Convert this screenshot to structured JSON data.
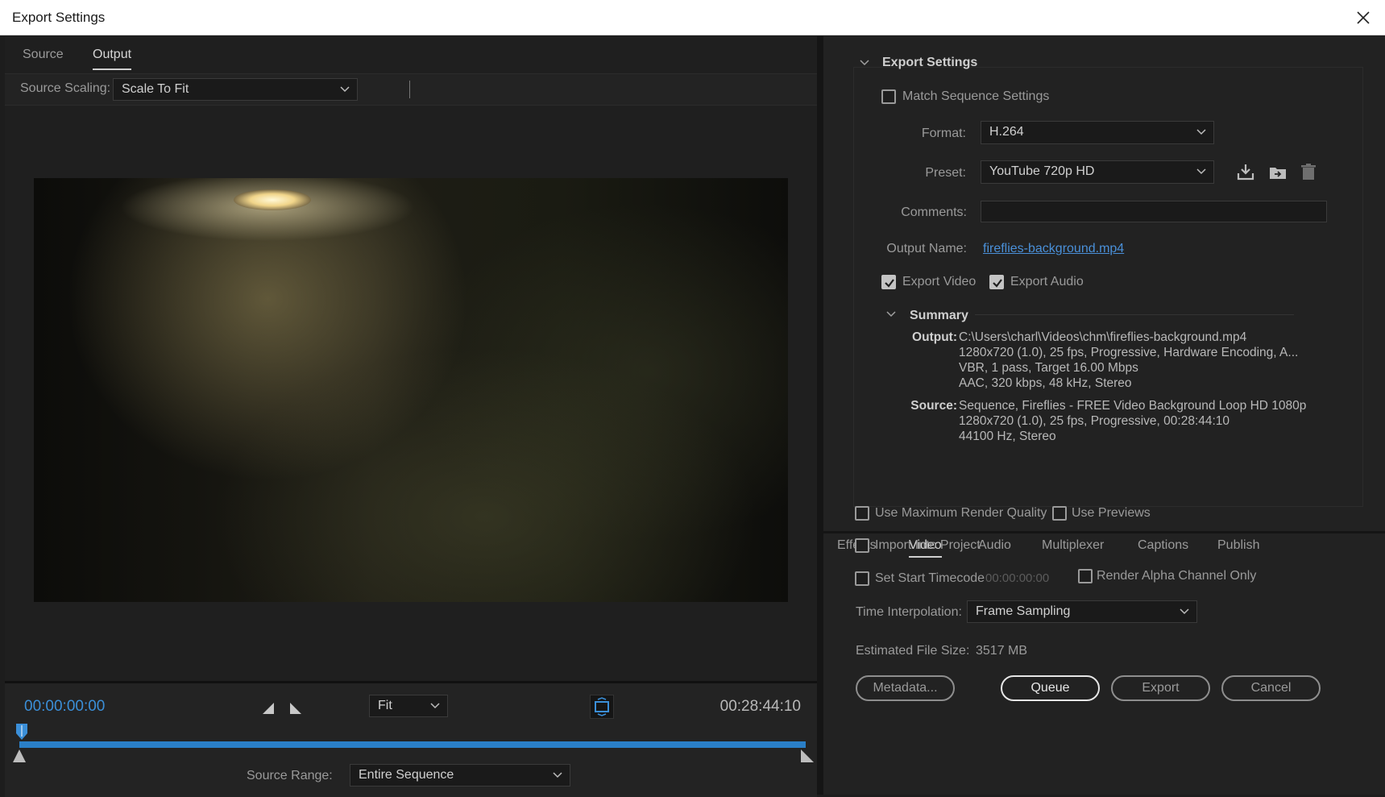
{
  "window": {
    "title": "Export Settings"
  },
  "left": {
    "tabs": [
      {
        "label": "Source"
      },
      {
        "label": "Output"
      }
    ],
    "source_scaling": {
      "label": "Source Scaling:",
      "value": "Scale To Fit"
    },
    "timecode_start": "00:00:00:00",
    "timecode_end": "00:28:44:10",
    "zoom": {
      "value": "Fit"
    },
    "source_range": {
      "label": "Source Range:",
      "value": "Entire Sequence"
    }
  },
  "export_settings": {
    "section_title": "Export Settings",
    "match_sequence": {
      "label": "Match Sequence Settings",
      "checked": false
    },
    "format": {
      "label": "Format:",
      "value": "H.264"
    },
    "preset": {
      "label": "Preset:",
      "value": "YouTube 720p HD"
    },
    "comments": {
      "label": "Comments:",
      "value": ""
    },
    "output_name": {
      "label": "Output Name:",
      "value": "fireflies-background.mp4"
    },
    "export_video": {
      "label": "Export Video",
      "checked": true
    },
    "export_audio": {
      "label": "Export Audio",
      "checked": true
    },
    "summary": {
      "title": "Summary",
      "output_label": "Output:",
      "output_lines": [
        "C:\\Users\\charl\\Videos\\chm\\fireflies-background.mp4",
        "1280x720 (1.0), 25 fps, Progressive, Hardware Encoding, A...",
        "VBR, 1 pass, Target 16.00 Mbps",
        "AAC, 320 kbps, 48 kHz, Stereo"
      ],
      "source_label": "Source:",
      "source_lines": [
        "Sequence, Fireflies - FREE Video Background Loop HD 1080p",
        "1280x720 (1.0), 25 fps, Progressive, 00:28:44:10",
        "44100 Hz, Stereo"
      ]
    }
  },
  "bottom_tabs": [
    {
      "label": "Effects"
    },
    {
      "label": "Video"
    },
    {
      "label": "Audio"
    },
    {
      "label": "Multiplexer"
    },
    {
      "label": "Captions"
    },
    {
      "label": "Publish"
    }
  ],
  "options": {
    "max_render": {
      "label": "Use Maximum Render Quality",
      "checked": false
    },
    "use_previews": {
      "label": "Use Previews",
      "checked": false
    },
    "import_project": {
      "label": "Import Into Project",
      "checked": false
    },
    "set_start_tc": {
      "label": "Set Start Timecode",
      "checked": false,
      "value": "00:00:00:00"
    },
    "alpha_only": {
      "label": "Render Alpha Channel Only",
      "checked": false
    },
    "time_interp": {
      "label": "Time Interpolation:",
      "value": "Frame Sampling"
    },
    "file_size": {
      "label": "Estimated File Size:",
      "value": "3517 MB"
    }
  },
  "buttons": {
    "metadata": "Metadata...",
    "queue": "Queue",
    "export": "Export",
    "cancel": "Cancel"
  }
}
